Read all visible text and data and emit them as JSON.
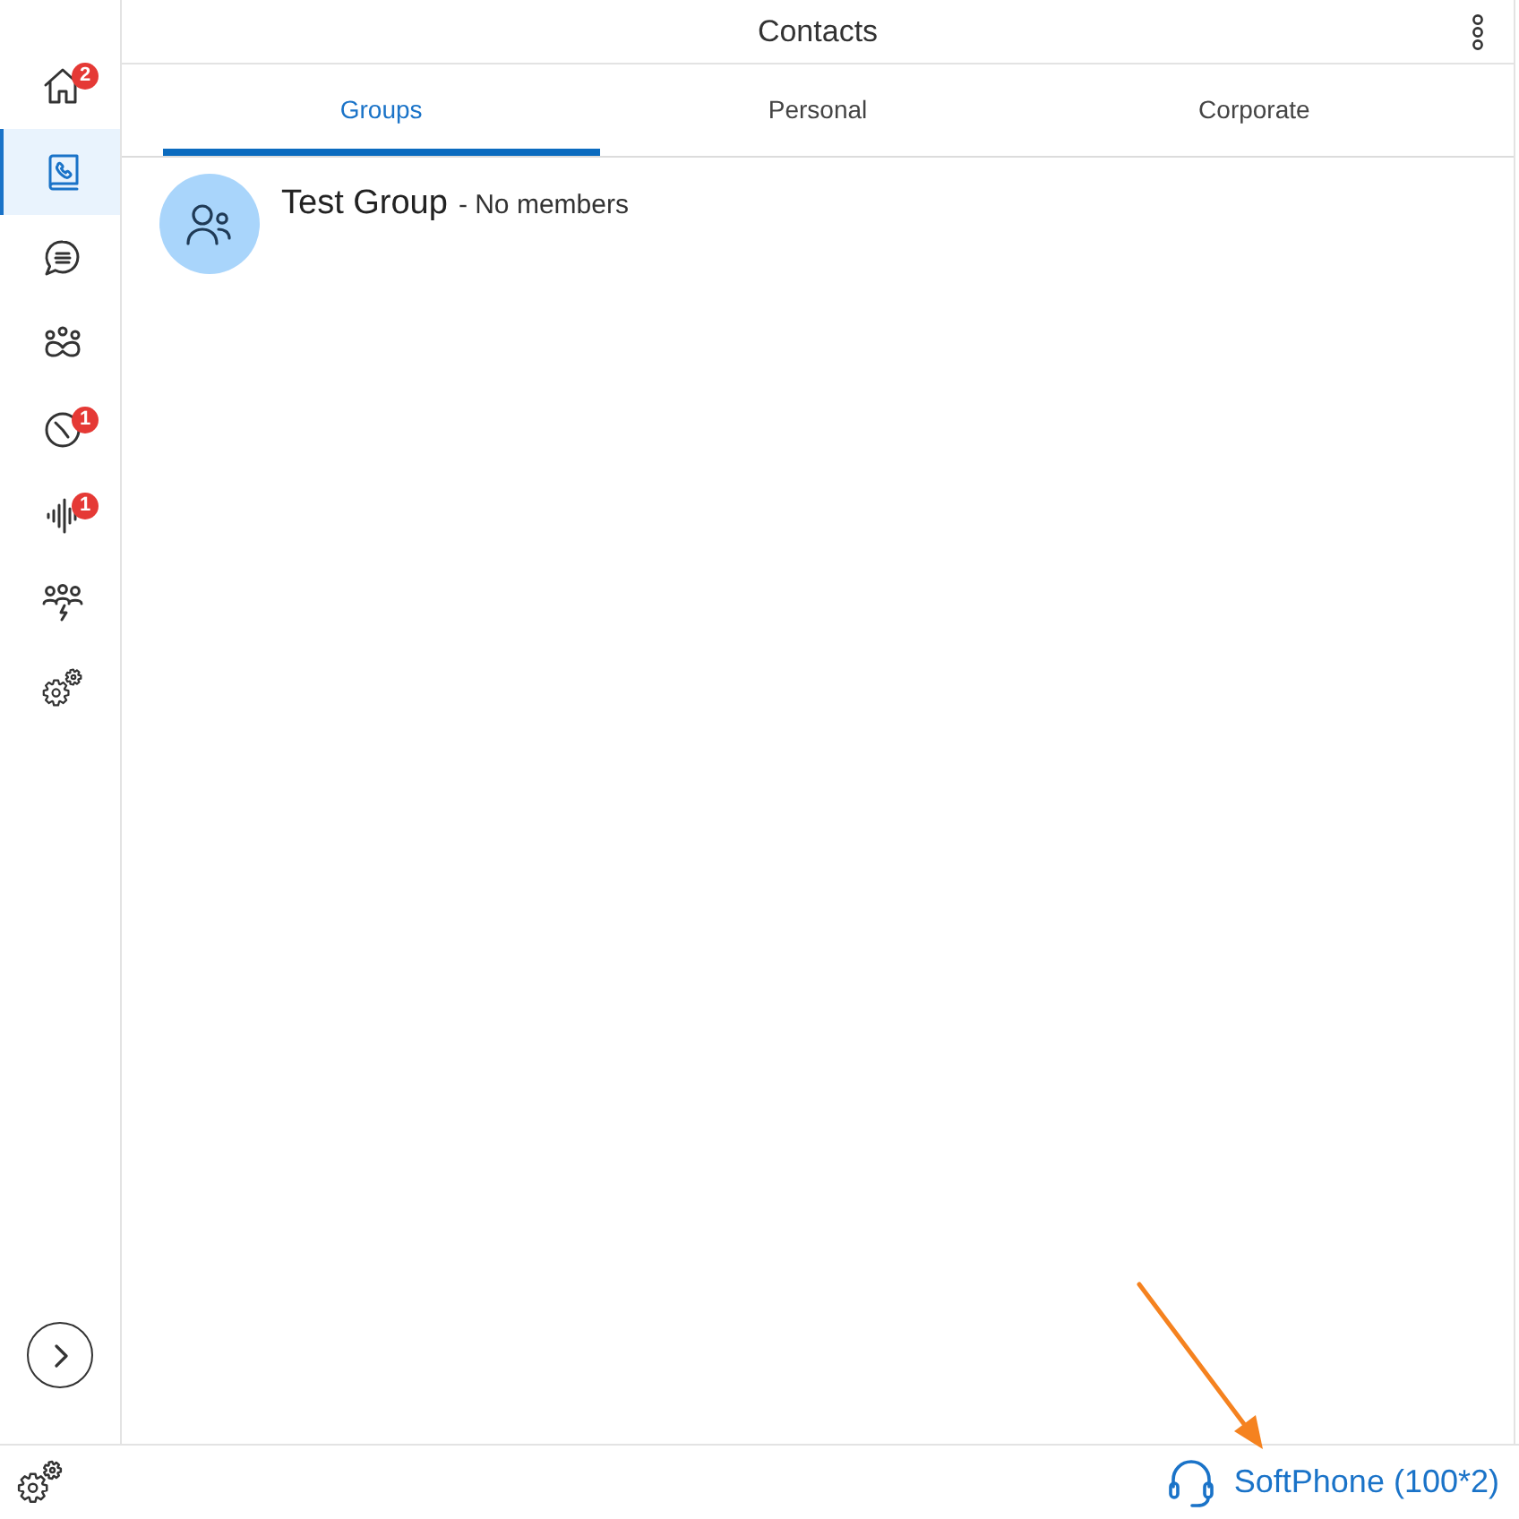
{
  "header": {
    "title": "Contacts"
  },
  "sidebar": {
    "items": [
      {
        "kind": "home",
        "badge": "2",
        "selected": false
      },
      {
        "kind": "contacts",
        "selected": true
      },
      {
        "kind": "chat",
        "selected": false
      },
      {
        "kind": "team",
        "selected": false
      },
      {
        "kind": "history",
        "badge": "1",
        "selected": false
      },
      {
        "kind": "voicemail",
        "badge": "1",
        "selected": false
      },
      {
        "kind": "conference",
        "selected": false
      },
      {
        "kind": "settings",
        "selected": false
      }
    ]
  },
  "tabs": [
    {
      "label": "Groups",
      "selected": true
    },
    {
      "label": "Personal",
      "selected": false
    },
    {
      "label": "Corporate",
      "selected": false
    }
  ],
  "groups": [
    {
      "name": "Test Group",
      "detail": "- No members"
    }
  ],
  "status_bar": {
    "phone_label": "SoftPhone (100*2)"
  },
  "annotations": [
    {
      "kind": "arrow"
    }
  ]
}
